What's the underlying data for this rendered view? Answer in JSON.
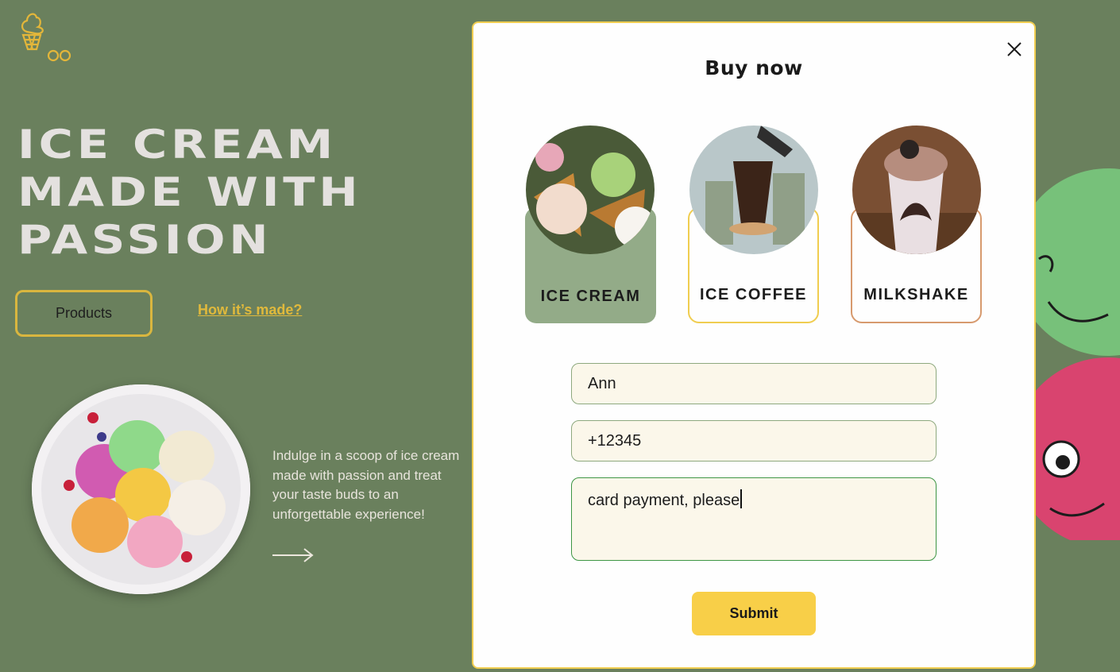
{
  "header": {
    "logo_icon": "ice-cream-cone-logo-icon"
  },
  "hero": {
    "title_lines": [
      "ICE CREAM",
      "MADE WITH",
      "PASSION"
    ],
    "products_button": "Products",
    "how_link": "How it’s made?",
    "promo_text": "Indulge in a scoop of ice cream made with passion and treat your taste buds to an unforgettable experience!",
    "arrow_icon": "arrow-right-icon"
  },
  "modal": {
    "title": "Buy now",
    "close_icon": "close-icon",
    "products": [
      {
        "label": "ICE CREAM",
        "selected": true,
        "accent": "#93ab88"
      },
      {
        "label": "ICE COFFEE",
        "selected": false,
        "accent": "#f0cd50"
      },
      {
        "label": "MILKSHAKE",
        "selected": false,
        "accent": "#d79a6e"
      }
    ],
    "form": {
      "name_value": "Ann",
      "phone_value": "+12345",
      "comment_value": "card payment, please"
    },
    "submit_label": "Submit"
  },
  "colors": {
    "background": "#6a805d",
    "accent_yellow": "#f8cf48",
    "field_bg": "#fbf7ea"
  }
}
